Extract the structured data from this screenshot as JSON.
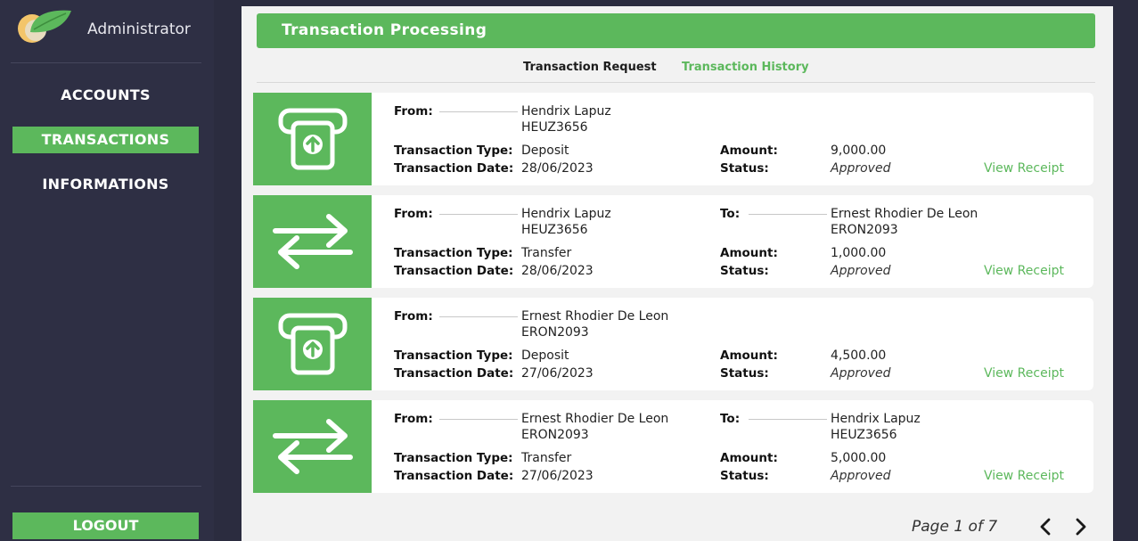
{
  "sidebar": {
    "brand": "Administrator",
    "nav": [
      {
        "label": "ACCOUNTS"
      },
      {
        "label": "TRANSACTIONS"
      },
      {
        "label": "INFORMATIONS"
      }
    ],
    "logout": "LOGOUT"
  },
  "header": {
    "title": "Transaction Processing"
  },
  "tabs": {
    "request": "Transaction Request",
    "history": "Transaction History"
  },
  "labels": {
    "from": "From:",
    "to": "To:",
    "type": "Transaction Type:",
    "date": "Transaction Date:",
    "amount": "Amount:",
    "status": "Status:",
    "receipt": "View Receipt"
  },
  "transactions": [
    {
      "icon": "deposit-icon",
      "from_name": "Hendrix Lapuz",
      "from_id": "HEUZ3656",
      "to_name": "",
      "to_id": "",
      "type": "Deposit",
      "date": "28/06/2023",
      "amount": "9,000.00",
      "status": "Approved"
    },
    {
      "icon": "transfer-icon",
      "from_name": "Hendrix Lapuz",
      "from_id": "HEUZ3656",
      "to_name": "Ernest Rhodier De Leon",
      "to_id": "ERON2093",
      "type": "Transfer",
      "date": "28/06/2023",
      "amount": "1,000.00",
      "status": "Approved"
    },
    {
      "icon": "deposit-icon",
      "from_name": "Ernest Rhodier De Leon",
      "from_id": "ERON2093",
      "to_name": "",
      "to_id": "",
      "type": "Deposit",
      "date": "27/06/2023",
      "amount": "4,500.00",
      "status": "Approved"
    },
    {
      "icon": "transfer-icon",
      "from_name": "Ernest Rhodier De Leon",
      "from_id": "ERON2093",
      "to_name": "Hendrix Lapuz",
      "to_id": "HEUZ3656",
      "type": "Transfer",
      "date": "27/06/2023",
      "amount": "5,000.00",
      "status": "Approved"
    }
  ],
  "pagination": {
    "text": "Page 1 of 7"
  },
  "colors": {
    "accent": "#5cb85c",
    "sidebar": "#2e2f44",
    "panel": "#f2f2f2"
  }
}
